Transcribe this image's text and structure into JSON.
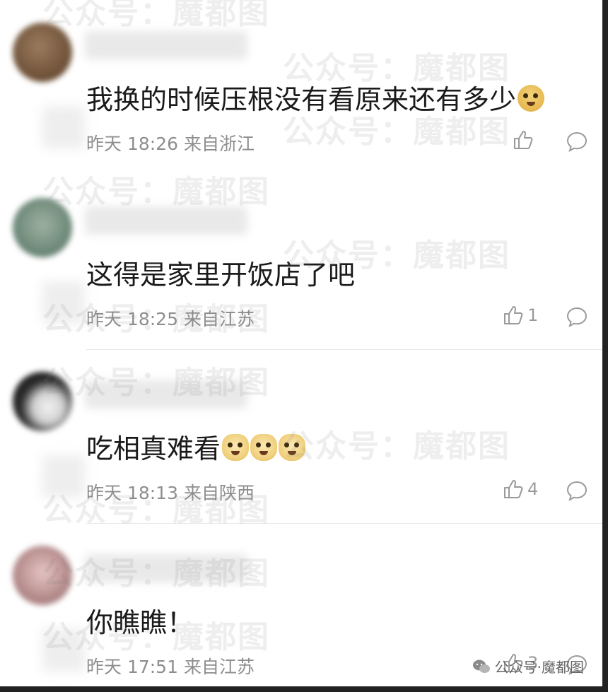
{
  "watermark": "公众号：魔都图",
  "brand": {
    "text": "公众号·魔都图",
    "icon": "wechat-icon"
  },
  "comments": [
    {
      "name": "",
      "text": "我换的时候压根没有看原来还有多少",
      "emojis": [
        "laugh-cry"
      ],
      "time": "昨天 18:26",
      "location": "来自浙江",
      "likes": ""
    },
    {
      "name": "",
      "text": "这得是家里开饭店了吧",
      "emojis": [],
      "time": "昨天 18:25",
      "location": "来自江苏",
      "likes": "1"
    },
    {
      "name": "",
      "text": "吃相真难看",
      "emojis": [
        "doge",
        "doge",
        "doge"
      ],
      "time": "昨天 18:13",
      "location": "来自陕西",
      "likes": "4"
    },
    {
      "name": "",
      "text": "你瞧瞧！",
      "emojis": [],
      "time": "昨天 17:51",
      "location": "来自江苏",
      "likes": "3"
    }
  ],
  "colors": {
    "text": "#1a1a1a",
    "meta": "#8e8e8e",
    "divider": "#e8e8e8"
  }
}
